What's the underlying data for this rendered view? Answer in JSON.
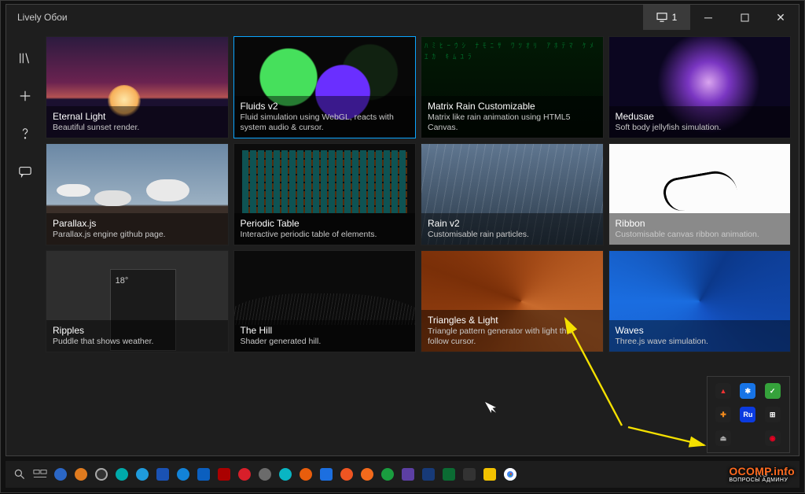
{
  "titlebar": {
    "title": "Lively Обои",
    "monitor_label": "1"
  },
  "sidebar": {
    "items": [
      {
        "name": "library",
        "icon": "library-icon"
      },
      {
        "name": "add",
        "icon": "plus-icon"
      },
      {
        "name": "help",
        "icon": "help-icon"
      },
      {
        "name": "about",
        "icon": "chat-icon"
      }
    ]
  },
  "wallpapers": [
    {
      "title": "Eternal Light",
      "desc": "Beautiful sunset render.",
      "thumb": "th-eternal",
      "selected": false
    },
    {
      "title": "Fluids v2",
      "desc": "Fluid simulation using WebGL, reacts with system audio & cursor.",
      "thumb": "th-fluids",
      "selected": true
    },
    {
      "title": "Matrix Rain Customizable",
      "desc": "Matrix like rain animation using HTML5 Canvas.",
      "thumb": "th-matrix",
      "selected": false
    },
    {
      "title": "Medusae",
      "desc": "Soft body jellyfish simulation.",
      "thumb": "th-medusae",
      "selected": false
    },
    {
      "title": "Parallax.js",
      "desc": "Parallax.js engine github page.",
      "thumb": "th-parallax",
      "selected": false
    },
    {
      "title": "Periodic Table",
      "desc": "Interactive periodic table of elements.",
      "thumb": "th-periodic",
      "selected": false
    },
    {
      "title": "Rain v2",
      "desc": "Customisable rain particles.",
      "thumb": "th-rain",
      "selected": false
    },
    {
      "title": "Ribbon",
      "desc": "Customisable canvas ribbon animation.",
      "thumb": "th-ribbon",
      "selected": false
    },
    {
      "title": "Ripples",
      "desc": "Puddle that shows weather.",
      "thumb": "th-ripples",
      "selected": false
    },
    {
      "title": "The Hill",
      "desc": "Shader generated hill.",
      "thumb": "th-hill",
      "selected": false
    },
    {
      "title": "Triangles & Light",
      "desc": "Triangle pattern generator with light that follow cursor.",
      "thumb": "th-tri",
      "selected": false
    },
    {
      "title": "Waves",
      "desc": "Three.js wave simulation.",
      "thumb": "th-waves",
      "selected": false
    }
  ],
  "taskbar": {
    "language": "RU",
    "apps": [
      {
        "name": "search",
        "kind": "svg"
      },
      {
        "name": "task-view",
        "kind": "svg"
      },
      {
        "name": "qbittorrent",
        "kind": "dot",
        "color": "#2b67c6"
      },
      {
        "name": "app-orange-hex",
        "kind": "dot",
        "color": "#e07b1f"
      },
      {
        "name": "app-target",
        "kind": "dot",
        "color": "#333",
        "ring": true
      },
      {
        "name": "app-down-arrow",
        "kind": "dot",
        "color": "#0aa"
      },
      {
        "name": "telegram",
        "kind": "dot",
        "color": "#1f9bdc"
      },
      {
        "name": "app-blue-square",
        "kind": "sq",
        "color": "#1a52b4"
      },
      {
        "name": "edge",
        "kind": "dot",
        "color": "#1283d8"
      },
      {
        "name": "app-save-disk",
        "kind": "sq",
        "color": "#0b5fbf"
      },
      {
        "name": "filezilla",
        "kind": "sq",
        "color": "#a00"
      },
      {
        "name": "opera",
        "kind": "dot",
        "color": "#d81f2a"
      },
      {
        "name": "app-grey-dot",
        "kind": "dot",
        "color": "#6b6b6b"
      },
      {
        "name": "app-cyan-dl",
        "kind": "dot",
        "color": "#09b5c3"
      },
      {
        "name": "vlc",
        "kind": "dot",
        "color": "#e85d0c"
      },
      {
        "name": "app-window",
        "kind": "sq",
        "color": "#1c6fe0"
      },
      {
        "name": "yandex",
        "kind": "dot",
        "color": "#e52"
      },
      {
        "name": "firefox",
        "kind": "dot",
        "color": "#f36a1c"
      },
      {
        "name": "chrome",
        "kind": "dot",
        "color": "#1a9d3f"
      },
      {
        "name": "app-purple",
        "kind": "sq",
        "color": "#5c3fa3"
      },
      {
        "name": "word",
        "kind": "sq",
        "color": "#173a78"
      },
      {
        "name": "excel",
        "kind": "sq",
        "color": "#0b6b33"
      },
      {
        "name": "calc",
        "kind": "sq",
        "color": "#333"
      },
      {
        "name": "notes",
        "kind": "sq",
        "color": "#f2c200"
      },
      {
        "name": "lively-tray",
        "kind": "dot",
        "color": "#e02",
        "chrome": true
      }
    ]
  },
  "tray": {
    "items": [
      {
        "name": "tray-a",
        "color": "#222",
        "glyph": "▲",
        "fg": "#e33"
      },
      {
        "name": "tray-bluetooth",
        "color": "#1774e6",
        "glyph": "✱"
      },
      {
        "name": "tray-ok",
        "color": "#35a23b",
        "glyph": "✓"
      },
      {
        "name": "tray-av",
        "color": "#222",
        "glyph": "✚",
        "fg": "#f28a1c"
      },
      {
        "name": "tray-ru",
        "color": "#0b3be0",
        "glyph": "Ru"
      },
      {
        "name": "tray-win",
        "color": "#222",
        "glyph": "⊞"
      },
      {
        "name": "tray-eject",
        "color": "#222",
        "glyph": "⏏",
        "fg": "#aaa"
      },
      {
        "name": "tray-lively",
        "color": "#222",
        "glyph": "◉",
        "fg": "#e02"
      }
    ]
  },
  "watermark": {
    "main": "OCOMP.info",
    "sub": "ВОПРОСЫ АДМИНУ"
  }
}
